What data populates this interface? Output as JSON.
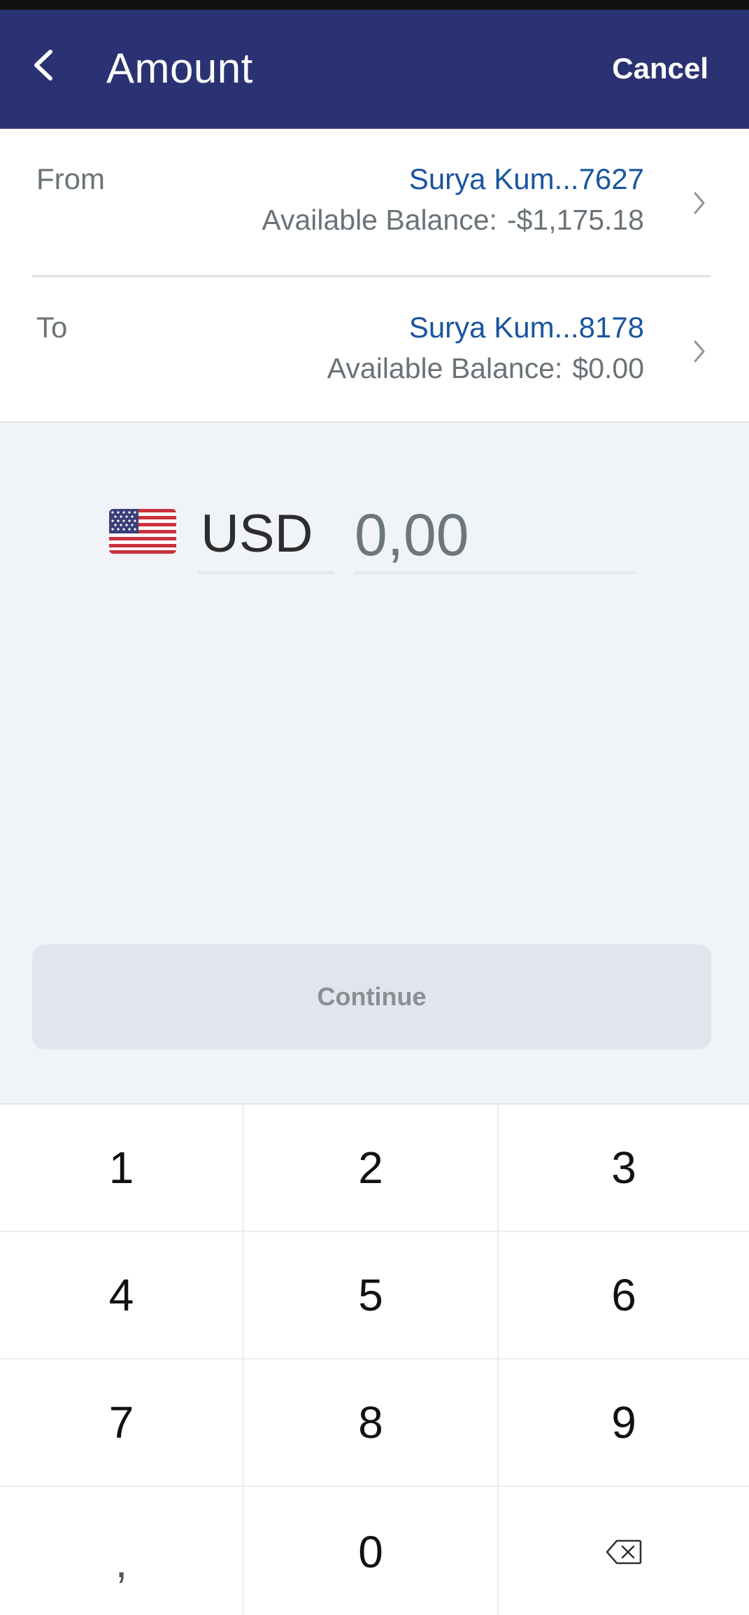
{
  "header": {
    "title": "Amount",
    "cancel_label": "Cancel",
    "background": "#2b3273"
  },
  "from_account": {
    "label": "From",
    "name": "Surya Kum...7627",
    "balance_label": "Available Balance:",
    "balance_value": "-$1,175.18"
  },
  "to_account": {
    "label": "To",
    "name": "Surya Kum...8178",
    "balance_label": "Available Balance:",
    "balance_value": "$0.00"
  },
  "amount": {
    "currency_code": "USD",
    "flag_icon": "us-flag-icon",
    "value": "",
    "placeholder": "0,00"
  },
  "continue_label": "Continue",
  "keypad": {
    "keys": [
      "1",
      "2",
      "3",
      "4",
      "5",
      "6",
      "7",
      "8",
      "9",
      ",",
      "0"
    ],
    "backspace_icon": "backspace-icon"
  },
  "colors": {
    "link": "#1a55a0",
    "page_bg": "#f0f3f7",
    "disabled_button": "#e1e6ee"
  }
}
